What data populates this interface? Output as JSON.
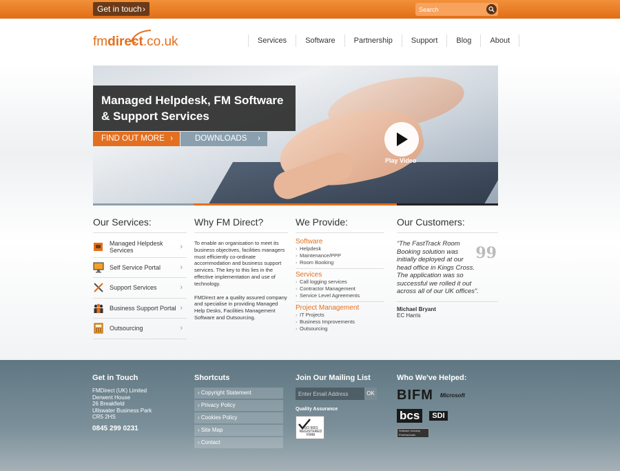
{
  "topbar": {
    "get_in_touch": "Get in touch",
    "search_placeholder": "Search"
  },
  "header": {
    "logo_text_fm": "fm",
    "logo_text_direct": "direct",
    "logo_text_tld": ".co.uk",
    "nav": [
      "Services",
      "Software",
      "Partnership",
      "Support",
      "Blog",
      "About"
    ]
  },
  "hero": {
    "title_line1": "Managed Helpdesk, FM Software",
    "title_line2": "& Support Services",
    "find_out_more": "FIND OUT MORE",
    "downloads": "DOWNLOADS",
    "play_label": "Play Video"
  },
  "services": {
    "heading": "Our Services:",
    "items": [
      {
        "label": "Managed Helpdesk Services",
        "icon": "helpdesk-icon"
      },
      {
        "label": "Self Service Portal",
        "icon": "monitor-icon"
      },
      {
        "label": "Support Services",
        "icon": "tools-icon"
      },
      {
        "label": "Business Support Portal",
        "icon": "people-icon"
      },
      {
        "label": "Outsourcing",
        "icon": "calculator-icon"
      }
    ]
  },
  "why": {
    "heading": "Why FM Direct?",
    "para1": "To enable an organisation to meet its business objectives, facilities managers must efficiently co-ordinate accommodation and business support services. The key to this lies in the effective implementation and use of technology.",
    "para2": "FMDirect are a quality assured company and specialise in providing Managed Help Desks, Facilities Management Software and Outsourcing."
  },
  "provide": {
    "heading": "We Provide:",
    "groups": [
      {
        "title": "Software",
        "items": [
          "Helpdesk",
          "Maintenance/PPP",
          "Room Booking"
        ]
      },
      {
        "title": "Services",
        "items": [
          "Call logging services",
          "Contractor Management",
          "Service Level Agreements"
        ]
      },
      {
        "title": "Project Management",
        "items": [
          "IT Projects",
          "Business Improvements",
          "Outsourcing"
        ]
      }
    ]
  },
  "customers": {
    "heading": "Our Customers:",
    "quote": "“The FastTrack Room Booking solution was initially deployed at our head office in Kings Cross. The application was so successful we rolled it out across all of our UK offices”.",
    "quote_mark": "99",
    "name": "Michael Bryant",
    "company": "EC Harris"
  },
  "footer": {
    "get_in_touch": {
      "heading": "Get in Touch",
      "address": [
        "FMDirect (UK) Limited",
        "Derwent House",
        "26 Breakfield",
        "Ullswater Business Park",
        "CR5 2HS"
      ],
      "phone": "0845 299 0231"
    },
    "shortcuts": {
      "heading": "Shortcuts",
      "links": [
        "Copyright Statement",
        "Privacy Policy",
        "Cookies Policy",
        "Site Map",
        "Contact"
      ]
    },
    "mailing": {
      "heading": "Join Our Mailing List",
      "placeholder": "Enter Email Address",
      "ok": "OK",
      "qa_label": "Quality Assurance",
      "iso_text": "ISO 9001 REGISTERED FIRM"
    },
    "helped": {
      "heading": "Who We've Helped:",
      "logos": {
        "bifm": "BIFM",
        "microsoft": "Microsoft",
        "bcs": "bcs",
        "sdi": "SDI",
        "swp": "Software Industry Professionals"
      }
    }
  },
  "colors": {
    "orange": "#e36f1b",
    "dark_brown": "#6b3a18",
    "footer_slate": "#607783",
    "steel_button": "#8aa0ae"
  }
}
